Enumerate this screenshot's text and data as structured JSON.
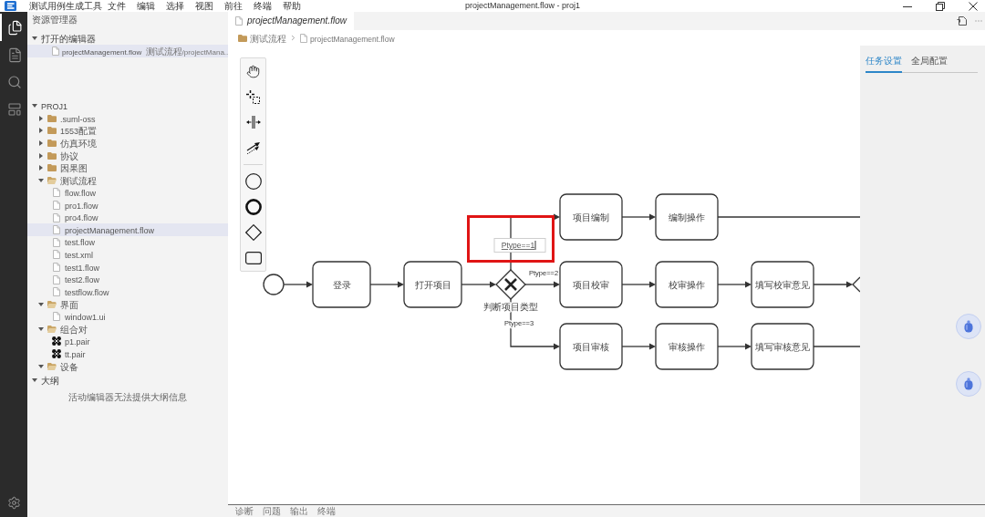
{
  "window": {
    "title": "projectManagement.flow - proj1"
  },
  "menu_bar": {
    "app_name": "测试用例生成工具",
    "items": [
      "文件",
      "编辑",
      "选择",
      "视图",
      "前往",
      "终端",
      "帮助"
    ]
  },
  "activity_bar": [
    {
      "selected": true
    },
    {
      "selected": false
    },
    {
      "selected": false
    },
    {
      "selected": false
    }
  ],
  "sidebar": {
    "title": "资源管理器",
    "open_editors": {
      "label": "打开的编辑器",
      "expanded": true,
      "items": [
        {
          "name": "projectManagement.flow",
          "path": "测试流程/projectMana...",
          "selected": true
        }
      ]
    },
    "project": {
      "label": "PROJ1",
      "expanded": true,
      "children": [
        {
          "kind": "folder",
          "name": ".suml-oss",
          "expanded": false,
          "selected": false
        },
        {
          "kind": "folder",
          "name": "1553配置",
          "expanded": false,
          "selected": false
        },
        {
          "kind": "folder",
          "name": "仿真环境",
          "expanded": false,
          "selected": false
        },
        {
          "kind": "folder",
          "name": "协议",
          "expanded": false,
          "selected": false
        },
        {
          "kind": "folder",
          "name": "因果图",
          "expanded": false,
          "selected": false
        },
        {
          "kind": "folder",
          "name": "测试流程",
          "expanded": true,
          "selected": false,
          "children": [
            {
              "kind": "file",
              "name": "flow.flow",
              "selected": false
            },
            {
              "kind": "file",
              "name": "pro1.flow",
              "selected": false
            },
            {
              "kind": "file",
              "name": "pro4.flow",
              "selected": false
            },
            {
              "kind": "file",
              "name": "projectManagement.flow",
              "selected": true
            },
            {
              "kind": "file",
              "name": "test.flow",
              "selected": false
            },
            {
              "kind": "file",
              "name": "test.xml",
              "selected": false
            },
            {
              "kind": "file",
              "name": "test1.flow",
              "selected": false
            },
            {
              "kind": "file",
              "name": "test2.flow",
              "selected": false
            },
            {
              "kind": "file",
              "name": "testflow.flow",
              "selected": false
            }
          ]
        },
        {
          "kind": "folder",
          "name": "界面",
          "expanded": true,
          "selected": false,
          "children": [
            {
              "kind": "file",
              "name": "window1.ui",
              "selected": false
            }
          ]
        },
        {
          "kind": "folder",
          "name": "组合对",
          "expanded": true,
          "selected": false,
          "children": [
            {
              "kind": "pair",
              "name": "p1.pair",
              "selected": false
            },
            {
              "kind": "pair",
              "name": "tt.pair",
              "selected": false
            }
          ]
        },
        {
          "kind": "folder",
          "name": "设备",
          "expanded": true,
          "selected": false
        }
      ]
    },
    "outline": {
      "label": "大纲",
      "expanded": true,
      "message": "活动编辑器无法提供大纲信息"
    }
  },
  "editor": {
    "tabs": [
      {
        "label": "projectManagement.flow",
        "selected": true
      }
    ],
    "breadcrumb": [
      "测试流程",
      "projectManagement.flow"
    ]
  },
  "diagram": {
    "flow": [
      {
        "kind": "start"
      },
      {
        "kind": "task",
        "label": "登录"
      },
      {
        "kind": "task",
        "label": "打开项目"
      },
      {
        "kind": "gateway",
        "label": "判断项目类型"
      }
    ],
    "branches": [
      {
        "condition": "Ptype==1",
        "editing": true,
        "highlighted": true,
        "tasks": [
          "项目编制",
          "编制操作"
        ],
        "ends_in_gateway": false
      },
      {
        "condition": "Ptype==2",
        "editing": false,
        "highlighted": false,
        "tasks": [
          "项目校审",
          "校审操作",
          "填写校审意见"
        ],
        "ends_in_gateway": true
      },
      {
        "condition": "Ptype==3",
        "editing": false,
        "highlighted": false,
        "tasks": [
          "项目审核",
          "审核操作",
          "填写审核意见"
        ],
        "ends_in_gateway": false
      }
    ]
  },
  "properties_panel": {
    "tabs": [
      {
        "label": "任务设置",
        "selected": true
      },
      {
        "label": "全局配置",
        "selected": false
      }
    ]
  },
  "bottom_panel": {
    "tabs": [
      "诊断",
      "问题",
      "输出",
      "终端"
    ]
  }
}
